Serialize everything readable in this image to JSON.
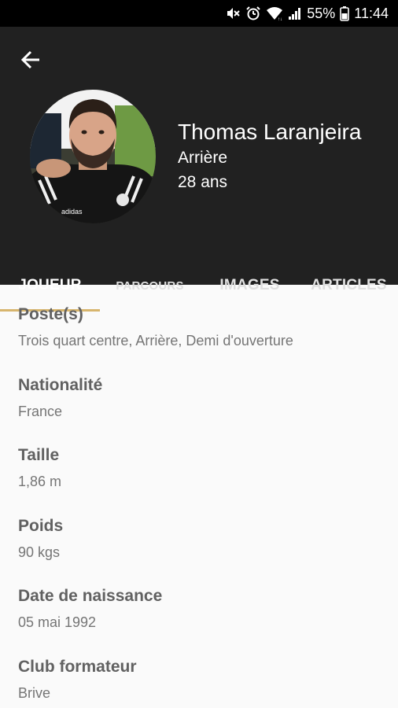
{
  "status_bar": {
    "battery_percent": "55%",
    "time": "11:44",
    "icons": [
      "mute-icon",
      "alarm-icon",
      "wifi-icon",
      "signal-icon",
      "battery-icon"
    ]
  },
  "header": {
    "back_icon": "arrow-left-icon",
    "player": {
      "name": "Thomas Laranjeira",
      "position": "Arrière",
      "age": "28 ans"
    }
  },
  "tabs": [
    {
      "label": "JOUEUR",
      "active": true
    },
    {
      "label": "PARCOURS",
      "active": false
    },
    {
      "label": "IMAGES",
      "active": false
    },
    {
      "label": "ARTICLES",
      "active": false
    }
  ],
  "details": [
    {
      "label": "Poste(s)",
      "value": "Trois quart centre, Arrière, Demi d'ouverture"
    },
    {
      "label": "Nationalité",
      "value": "France"
    },
    {
      "label": "Taille",
      "value": "1,86 m"
    },
    {
      "label": "Poids",
      "value": "90 kgs"
    },
    {
      "label": "Date de naissance",
      "value": "05 mai 1992"
    },
    {
      "label": "Club formateur",
      "value": "Brive"
    }
  ],
  "colors": {
    "header_bg": "#212121",
    "tab_indicator": "#d7b56d",
    "content_bg": "#fafafa",
    "label_text": "#616161",
    "value_text": "#757575"
  }
}
